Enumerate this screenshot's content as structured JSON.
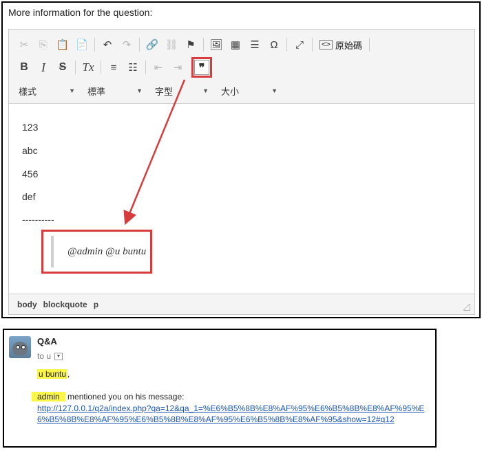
{
  "question_label": "More information for the question:",
  "toolbar": {
    "row1": [
      {
        "icon": "cut-icon",
        "glyph": "✂",
        "disabled": true
      },
      {
        "icon": "copy-icon",
        "glyph": "⎘",
        "disabled": true
      },
      {
        "icon": "paste-icon",
        "glyph": "📋",
        "disabled": false
      },
      {
        "icon": "paste-text-icon",
        "glyph": "📄",
        "disabled": false
      },
      {
        "icon": "undo-icon",
        "glyph": "↶",
        "disabled": false
      },
      {
        "icon": "redo-icon",
        "glyph": "↷",
        "disabled": true
      },
      {
        "icon": "link-icon",
        "glyph": "🔗",
        "disabled": false
      },
      {
        "icon": "unlink-icon",
        "glyph": "⛓",
        "disabled": true
      },
      {
        "icon": "anchor-flag-icon",
        "glyph": "⚑",
        "disabled": false
      },
      {
        "icon": "image-icon",
        "glyph": "🖼",
        "disabled": false
      },
      {
        "icon": "table-icon",
        "glyph": "▦",
        "disabled": false
      },
      {
        "icon": "horizontal-line-icon",
        "glyph": "☰",
        "disabled": false
      },
      {
        "icon": "special-char-icon",
        "glyph": "Ω",
        "disabled": false
      },
      {
        "icon": "maximize-icon",
        "glyph": "⤢",
        "disabled": false
      }
    ],
    "source_label": "原始碼",
    "row2": [
      {
        "icon": "bold-icon",
        "glyph": "B"
      },
      {
        "icon": "italic-icon",
        "glyph": "I"
      },
      {
        "icon": "strike-icon",
        "glyph": "S"
      },
      {
        "icon": "remove-format-icon",
        "glyph": "Tx"
      },
      {
        "icon": "numbered-list-icon",
        "glyph": "≡"
      },
      {
        "icon": "bulleted-list-icon",
        "glyph": "☷"
      },
      {
        "icon": "outdent-icon",
        "glyph": "⇤"
      },
      {
        "icon": "indent-icon",
        "glyph": "⇥"
      }
    ],
    "blockquote_glyph": "❞",
    "combos": [
      {
        "label": "樣式"
      },
      {
        "label": "標準"
      },
      {
        "label": "字型"
      },
      {
        "label": "大小"
      }
    ],
    "combo_arrow": "▼"
  },
  "content": {
    "lines": [
      "123",
      "abc",
      "456",
      "def",
      "----------"
    ],
    "blockquote": "@admin @u buntu"
  },
  "status_path": [
    "body",
    "blockquote",
    "p"
  ],
  "email": {
    "sender": "Q&A",
    "to": "to u",
    "dropdown_glyph": "▼",
    "greeting_name": "u buntu",
    "greeting_suffix": ",",
    "mention_user": "admin",
    "mention_text": " mentioned you on his message:",
    "link": "http://127.0.0.1/q2a/index.php?qa=12&qa_1=%E6%B5%8B%E8%AF%95%E6%B5%8B%E8%AF%95%E6%B5%8B%E8%AF%95%E6%B5%8B%E8%AF%95%E6%B5%8B%E8%AF%95&show=12#q12"
  },
  "colors": {
    "highlight_red": "#d73b3b",
    "mark_yellow": "#fcf64a",
    "link_blue": "#1a55b5"
  }
}
